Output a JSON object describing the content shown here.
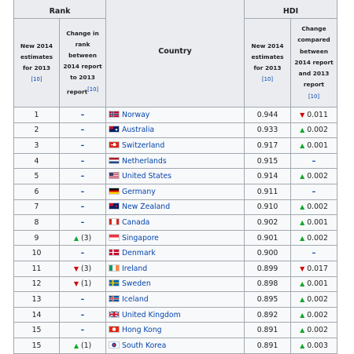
{
  "header": {
    "rank_group": "Rank",
    "hdi_group": "HDI",
    "rank_new_lines": [
      "New 2014",
      "estimates",
      "for 2013"
    ],
    "rank_new_ref": "[10]",
    "rank_change_lines": [
      "Change in",
      "rank",
      "between",
      "2014 report",
      "to 2013",
      "report"
    ],
    "rank_change_ref": "[10]",
    "country": "Country",
    "hdi_new_lines": [
      "New 2014",
      "estimates",
      "for 2013"
    ],
    "hdi_new_ref": "[10]",
    "hdi_change_lines": [
      "Change",
      "compared",
      "between",
      "2014 report",
      "and 2013",
      "report"
    ],
    "hdi_change_ref": "[10]"
  },
  "rows": [
    {
      "rank": "1",
      "rank_change": "–",
      "rank_dir": "none",
      "country": "Norway",
      "flag": "norway-flag",
      "hdi": "0.944",
      "hdi_change": "0.011",
      "hdi_dir": "down"
    },
    {
      "rank": "2",
      "rank_change": "–",
      "rank_dir": "none",
      "country": "Australia",
      "flag": "australia-flag",
      "hdi": "0.933",
      "hdi_change": "0.002",
      "hdi_dir": "up"
    },
    {
      "rank": "3",
      "rank_change": "–",
      "rank_dir": "none",
      "country": "Switzerland",
      "flag": "switzerland-flag",
      "hdi": "0.917",
      "hdi_change": "0.001",
      "hdi_dir": "up"
    },
    {
      "rank": "4",
      "rank_change": "–",
      "rank_dir": "none",
      "country": "Netherlands",
      "flag": "netherlands-flag",
      "hdi": "0.915",
      "hdi_change": "–",
      "hdi_dir": "none"
    },
    {
      "rank": "5",
      "rank_change": "–",
      "rank_dir": "none",
      "country": "United States",
      "flag": "united-states-flag",
      "hdi": "0.914",
      "hdi_change": "0.002",
      "hdi_dir": "up"
    },
    {
      "rank": "6",
      "rank_change": "–",
      "rank_dir": "none",
      "country": "Germany",
      "flag": "germany-flag",
      "hdi": "0.911",
      "hdi_change": "–",
      "hdi_dir": "none"
    },
    {
      "rank": "7",
      "rank_change": "–",
      "rank_dir": "none",
      "country": "New Zealand",
      "flag": "new-zealand-flag",
      "hdi": "0.910",
      "hdi_change": "0.002",
      "hdi_dir": "up"
    },
    {
      "rank": "8",
      "rank_change": "–",
      "rank_dir": "none",
      "country": "Canada",
      "flag": "canada-flag",
      "hdi": "0.902",
      "hdi_change": "0.001",
      "hdi_dir": "up"
    },
    {
      "rank": "9",
      "rank_change": "(3)",
      "rank_dir": "up",
      "country": "Singapore",
      "flag": "singapore-flag",
      "hdi": "0.901",
      "hdi_change": "0.002",
      "hdi_dir": "up"
    },
    {
      "rank": "10",
      "rank_change": "–",
      "rank_dir": "none",
      "country": "Denmark",
      "flag": "denmark-flag",
      "hdi": "0.900",
      "hdi_change": "–",
      "hdi_dir": "none"
    },
    {
      "rank": "11",
      "rank_change": "(3)",
      "rank_dir": "down",
      "country": "Ireland",
      "flag": "ireland-flag",
      "hdi": "0.899",
      "hdi_change": "0.017",
      "hdi_dir": "down"
    },
    {
      "rank": "12",
      "rank_change": "(1)",
      "rank_dir": "down",
      "country": "Sweden",
      "flag": "sweden-flag",
      "hdi": "0.898",
      "hdi_change": "0.001",
      "hdi_dir": "up"
    },
    {
      "rank": "13",
      "rank_change": "–",
      "rank_dir": "none",
      "country": "Iceland",
      "flag": "iceland-flag",
      "hdi": "0.895",
      "hdi_change": "0.002",
      "hdi_dir": "up"
    },
    {
      "rank": "14",
      "rank_change": "–",
      "rank_dir": "none",
      "country": "United Kingdom",
      "flag": "united-kingdom-flag",
      "hdi": "0.892",
      "hdi_change": "0.002",
      "hdi_dir": "up"
    },
    {
      "rank": "15",
      "rank_change": "–",
      "rank_dir": "none",
      "country": "Hong Kong",
      "flag": "hong-kong-flag",
      "hdi": "0.891",
      "hdi_change": "0.002",
      "hdi_dir": "up"
    },
    {
      "rank": "15",
      "rank_change": "(1)",
      "rank_dir": "up",
      "country": "South Korea",
      "flag": "south-korea-flag",
      "hdi": "0.891",
      "hdi_change": "0.003",
      "hdi_dir": "up"
    }
  ],
  "colors": {
    "up": "#14a52c",
    "down": "#d40000",
    "link": "#0645ad",
    "header_bg": "#eaecf0",
    "cell_bg": "#f8f9fa",
    "border": "#a2a9b1"
  }
}
